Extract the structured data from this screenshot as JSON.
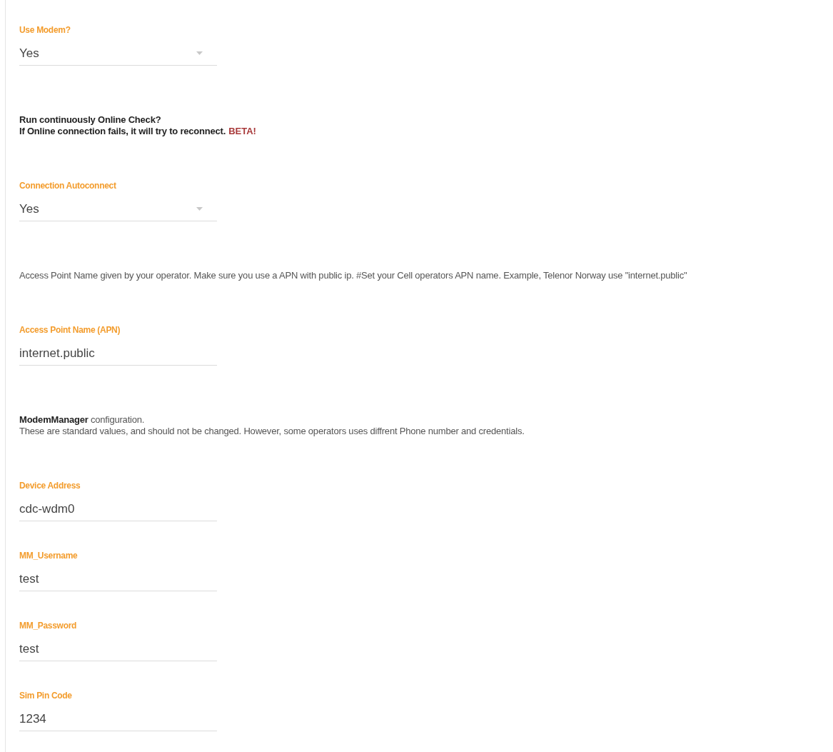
{
  "blocks": [
    {
      "kind": "select",
      "label": "Use Modem?",
      "value": "Yes"
    },
    {
      "kind": "note",
      "bold": true,
      "lines": [
        "Run continuously Online Check?",
        "If Online connection fails, it will try to reconnect."
      ],
      "tag": "BETA!"
    },
    {
      "kind": "select",
      "label": "Connection Autoconnect",
      "value": "Yes"
    },
    {
      "kind": "note",
      "bold": false,
      "lines": [
        "Access Point Name given by your operator. Make sure you use a APN with public ip. #Set your Cell operators APN name. Example, Telenor Norway use \"internet.public\""
      ]
    },
    {
      "kind": "input",
      "label": "Access Point Name (APN)",
      "value": "internet.public"
    },
    {
      "kind": "note",
      "bold": false,
      "lines": [
        "**ModemManager** configuration.",
        "These are standard values, and should not be changed. However, some operators uses diffrent Phone number and credentials."
      ]
    },
    {
      "kind": "input",
      "label": "Device Address",
      "value": "cdc-wdm0"
    },
    {
      "kind": "input",
      "label": "MM_Username",
      "value": "test"
    },
    {
      "kind": "input",
      "label": "MM_Password",
      "value": "test"
    },
    {
      "kind": "input",
      "label": "Sim Pin Code",
      "value": "1234"
    }
  ]
}
